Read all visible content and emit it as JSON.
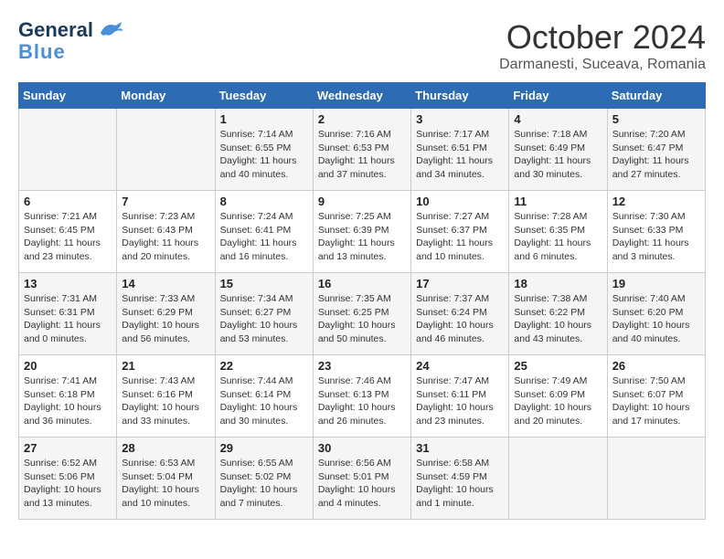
{
  "header": {
    "logo_line1": "General",
    "logo_line2": "Blue",
    "month": "October 2024",
    "location": "Darmanesti, Suceava, Romania"
  },
  "days_of_week": [
    "Sunday",
    "Monday",
    "Tuesday",
    "Wednesday",
    "Thursday",
    "Friday",
    "Saturday"
  ],
  "weeks": [
    [
      {
        "day": "",
        "info": ""
      },
      {
        "day": "",
        "info": ""
      },
      {
        "day": "1",
        "info": "Sunrise: 7:14 AM\nSunset: 6:55 PM\nDaylight: 11 hours and 40 minutes."
      },
      {
        "day": "2",
        "info": "Sunrise: 7:16 AM\nSunset: 6:53 PM\nDaylight: 11 hours and 37 minutes."
      },
      {
        "day": "3",
        "info": "Sunrise: 7:17 AM\nSunset: 6:51 PM\nDaylight: 11 hours and 34 minutes."
      },
      {
        "day": "4",
        "info": "Sunrise: 7:18 AM\nSunset: 6:49 PM\nDaylight: 11 hours and 30 minutes."
      },
      {
        "day": "5",
        "info": "Sunrise: 7:20 AM\nSunset: 6:47 PM\nDaylight: 11 hours and 27 minutes."
      }
    ],
    [
      {
        "day": "6",
        "info": "Sunrise: 7:21 AM\nSunset: 6:45 PM\nDaylight: 11 hours and 23 minutes."
      },
      {
        "day": "7",
        "info": "Sunrise: 7:23 AM\nSunset: 6:43 PM\nDaylight: 11 hours and 20 minutes."
      },
      {
        "day": "8",
        "info": "Sunrise: 7:24 AM\nSunset: 6:41 PM\nDaylight: 11 hours and 16 minutes."
      },
      {
        "day": "9",
        "info": "Sunrise: 7:25 AM\nSunset: 6:39 PM\nDaylight: 11 hours and 13 minutes."
      },
      {
        "day": "10",
        "info": "Sunrise: 7:27 AM\nSunset: 6:37 PM\nDaylight: 11 hours and 10 minutes."
      },
      {
        "day": "11",
        "info": "Sunrise: 7:28 AM\nSunset: 6:35 PM\nDaylight: 11 hours and 6 minutes."
      },
      {
        "day": "12",
        "info": "Sunrise: 7:30 AM\nSunset: 6:33 PM\nDaylight: 11 hours and 3 minutes."
      }
    ],
    [
      {
        "day": "13",
        "info": "Sunrise: 7:31 AM\nSunset: 6:31 PM\nDaylight: 11 hours and 0 minutes."
      },
      {
        "day": "14",
        "info": "Sunrise: 7:33 AM\nSunset: 6:29 PM\nDaylight: 10 hours and 56 minutes."
      },
      {
        "day": "15",
        "info": "Sunrise: 7:34 AM\nSunset: 6:27 PM\nDaylight: 10 hours and 53 minutes."
      },
      {
        "day": "16",
        "info": "Sunrise: 7:35 AM\nSunset: 6:25 PM\nDaylight: 10 hours and 50 minutes."
      },
      {
        "day": "17",
        "info": "Sunrise: 7:37 AM\nSunset: 6:24 PM\nDaylight: 10 hours and 46 minutes."
      },
      {
        "day": "18",
        "info": "Sunrise: 7:38 AM\nSunset: 6:22 PM\nDaylight: 10 hours and 43 minutes."
      },
      {
        "day": "19",
        "info": "Sunrise: 7:40 AM\nSunset: 6:20 PM\nDaylight: 10 hours and 40 minutes."
      }
    ],
    [
      {
        "day": "20",
        "info": "Sunrise: 7:41 AM\nSunset: 6:18 PM\nDaylight: 10 hours and 36 minutes."
      },
      {
        "day": "21",
        "info": "Sunrise: 7:43 AM\nSunset: 6:16 PM\nDaylight: 10 hours and 33 minutes."
      },
      {
        "day": "22",
        "info": "Sunrise: 7:44 AM\nSunset: 6:14 PM\nDaylight: 10 hours and 30 minutes."
      },
      {
        "day": "23",
        "info": "Sunrise: 7:46 AM\nSunset: 6:13 PM\nDaylight: 10 hours and 26 minutes."
      },
      {
        "day": "24",
        "info": "Sunrise: 7:47 AM\nSunset: 6:11 PM\nDaylight: 10 hours and 23 minutes."
      },
      {
        "day": "25",
        "info": "Sunrise: 7:49 AM\nSunset: 6:09 PM\nDaylight: 10 hours and 20 minutes."
      },
      {
        "day": "26",
        "info": "Sunrise: 7:50 AM\nSunset: 6:07 PM\nDaylight: 10 hours and 17 minutes."
      }
    ],
    [
      {
        "day": "27",
        "info": "Sunrise: 6:52 AM\nSunset: 5:06 PM\nDaylight: 10 hours and 13 minutes."
      },
      {
        "day": "28",
        "info": "Sunrise: 6:53 AM\nSunset: 5:04 PM\nDaylight: 10 hours and 10 minutes."
      },
      {
        "day": "29",
        "info": "Sunrise: 6:55 AM\nSunset: 5:02 PM\nDaylight: 10 hours and 7 minutes."
      },
      {
        "day": "30",
        "info": "Sunrise: 6:56 AM\nSunset: 5:01 PM\nDaylight: 10 hours and 4 minutes."
      },
      {
        "day": "31",
        "info": "Sunrise: 6:58 AM\nSunset: 4:59 PM\nDaylight: 10 hours and 1 minute."
      },
      {
        "day": "",
        "info": ""
      },
      {
        "day": "",
        "info": ""
      }
    ]
  ]
}
